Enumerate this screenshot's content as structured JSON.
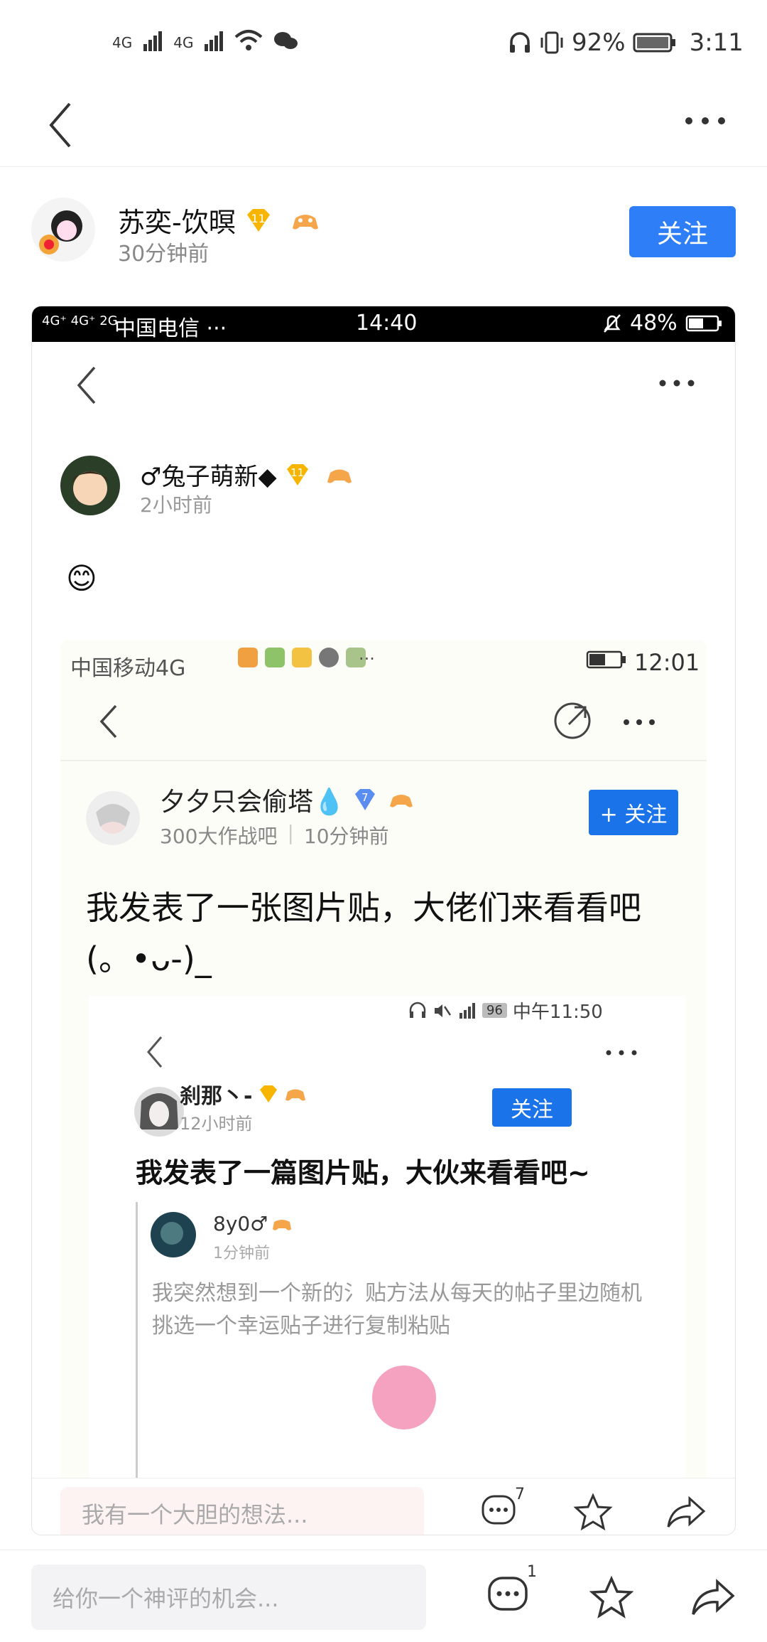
{
  "status_bar": {
    "net1": "4G",
    "net2": "4G",
    "battery_pct": "92%",
    "time": "3:11"
  },
  "post": {
    "author": "苏奕-饮暝",
    "level_badge": "11",
    "time": "30分钟前",
    "follow_label": "关注"
  },
  "shot1": {
    "status": {
      "net": "4G⁺ 4G⁺ 2G",
      "carrier": "中国电信 ···",
      "time": "14:40",
      "battery": "48%"
    },
    "author": "♂兔子萌新◆",
    "level_badge": "11",
    "time": "2小时前",
    "body_emoji": "😊",
    "comment_placeholder": "我有一个大胆的想法...",
    "comment_count": "7"
  },
  "shot2": {
    "status": {
      "carrier": "中国移动4G",
      "extra": "···",
      "time": "12:01"
    },
    "author": "夕夕只会偷塔💧",
    "level_badge": "7",
    "forum": "300大作战吧",
    "time": "10分钟前",
    "follow_label": "+ 关注",
    "title": "我发表了一张图片贴，大佬们来看看吧(。•ᴗ-)_"
  },
  "shot3": {
    "status": {
      "battery": "96",
      "time": "中午11:50"
    },
    "author": "刹那丶-",
    "time": "12小时前",
    "follow_label": "关注",
    "title": "我发表了一篇图片贴，大伙来看看吧~",
    "quote_author": "8y0♂",
    "quote_time": "1分钟前",
    "quote_text": "我突然想到一个新的氵贴方法从每天的帖子里边随机挑选一个幸运贴子进行复制粘贴"
  },
  "bottom": {
    "placeholder": "给你一个神评的机会...",
    "comment_count": "1"
  },
  "colors": {
    "accent": "#2d7ef7",
    "follow2": "#1a73e8"
  }
}
